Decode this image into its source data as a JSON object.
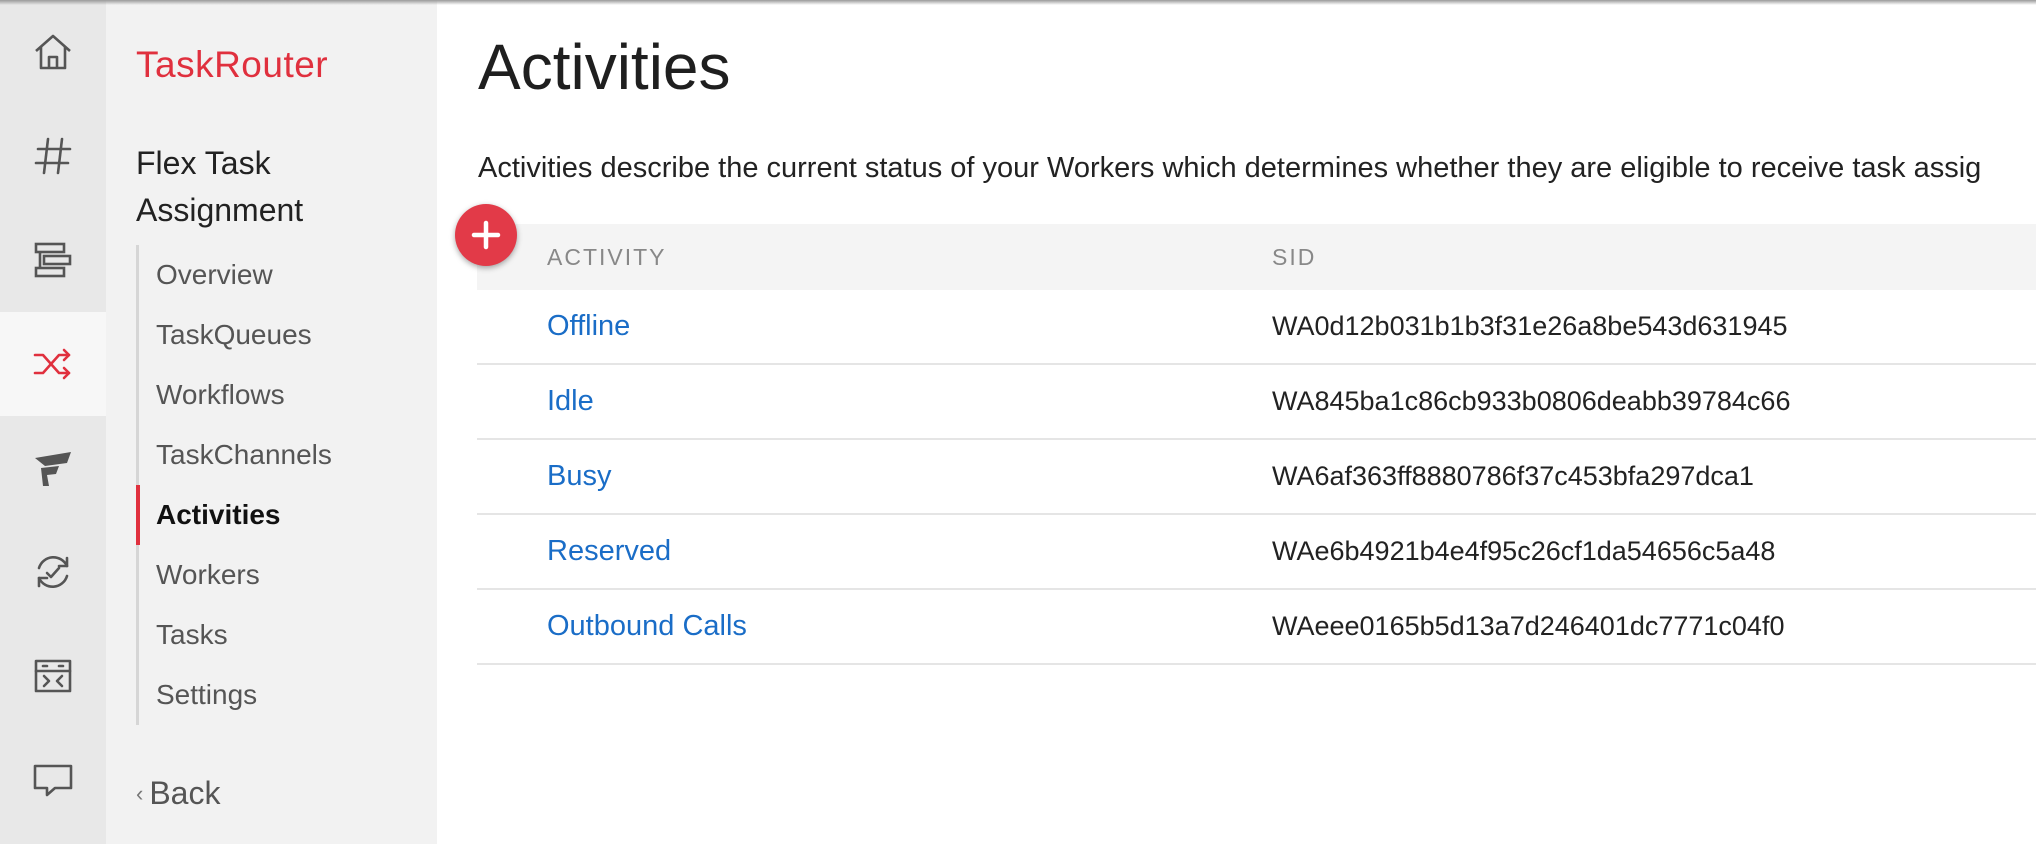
{
  "rail": {
    "items": [
      {
        "icon": "home-icon"
      },
      {
        "icon": "hash-icon"
      },
      {
        "icon": "studio-icon"
      },
      {
        "icon": "taskrouter-shuffle-icon",
        "active": true
      },
      {
        "icon": "flex-icon"
      },
      {
        "icon": "sync-icon"
      },
      {
        "icon": "runtime-icon"
      },
      {
        "icon": "chat-icon"
      }
    ]
  },
  "subnav": {
    "product": "TaskRouter",
    "workspace": "Flex Task Assignment",
    "items": [
      {
        "label": "Overview"
      },
      {
        "label": "TaskQueues"
      },
      {
        "label": "Workflows"
      },
      {
        "label": "TaskChannels"
      },
      {
        "label": "Activities",
        "active": true
      },
      {
        "label": "Workers"
      },
      {
        "label": "Tasks"
      },
      {
        "label": "Settings"
      }
    ],
    "back_label": "Back"
  },
  "main": {
    "title": "Activities",
    "description": "Activities describe the current status of your Workers which determines whether they are eligible to receive task assig",
    "table": {
      "headers": {
        "activity": "ACTIVITY",
        "sid": "SID"
      },
      "rows": [
        {
          "activity": "Offline",
          "sid": "WA0d12b031b1b3f31e26a8be543d631945"
        },
        {
          "activity": "Idle",
          "sid": "WA845ba1c86cb933b0806deabb39784c66"
        },
        {
          "activity": "Busy",
          "sid": "WA6af363ff8880786f37c453bfa297dca1"
        },
        {
          "activity": "Reserved",
          "sid": "WAe6b4921b4e4f95c26cf1da54656c5a48"
        },
        {
          "activity": "Outbound Calls",
          "sid": "WAeee0165b5d13a7d246401dc7771c04f0"
        }
      ]
    }
  },
  "colors": {
    "accent": "#e0303e",
    "link": "#1a6dc7"
  }
}
